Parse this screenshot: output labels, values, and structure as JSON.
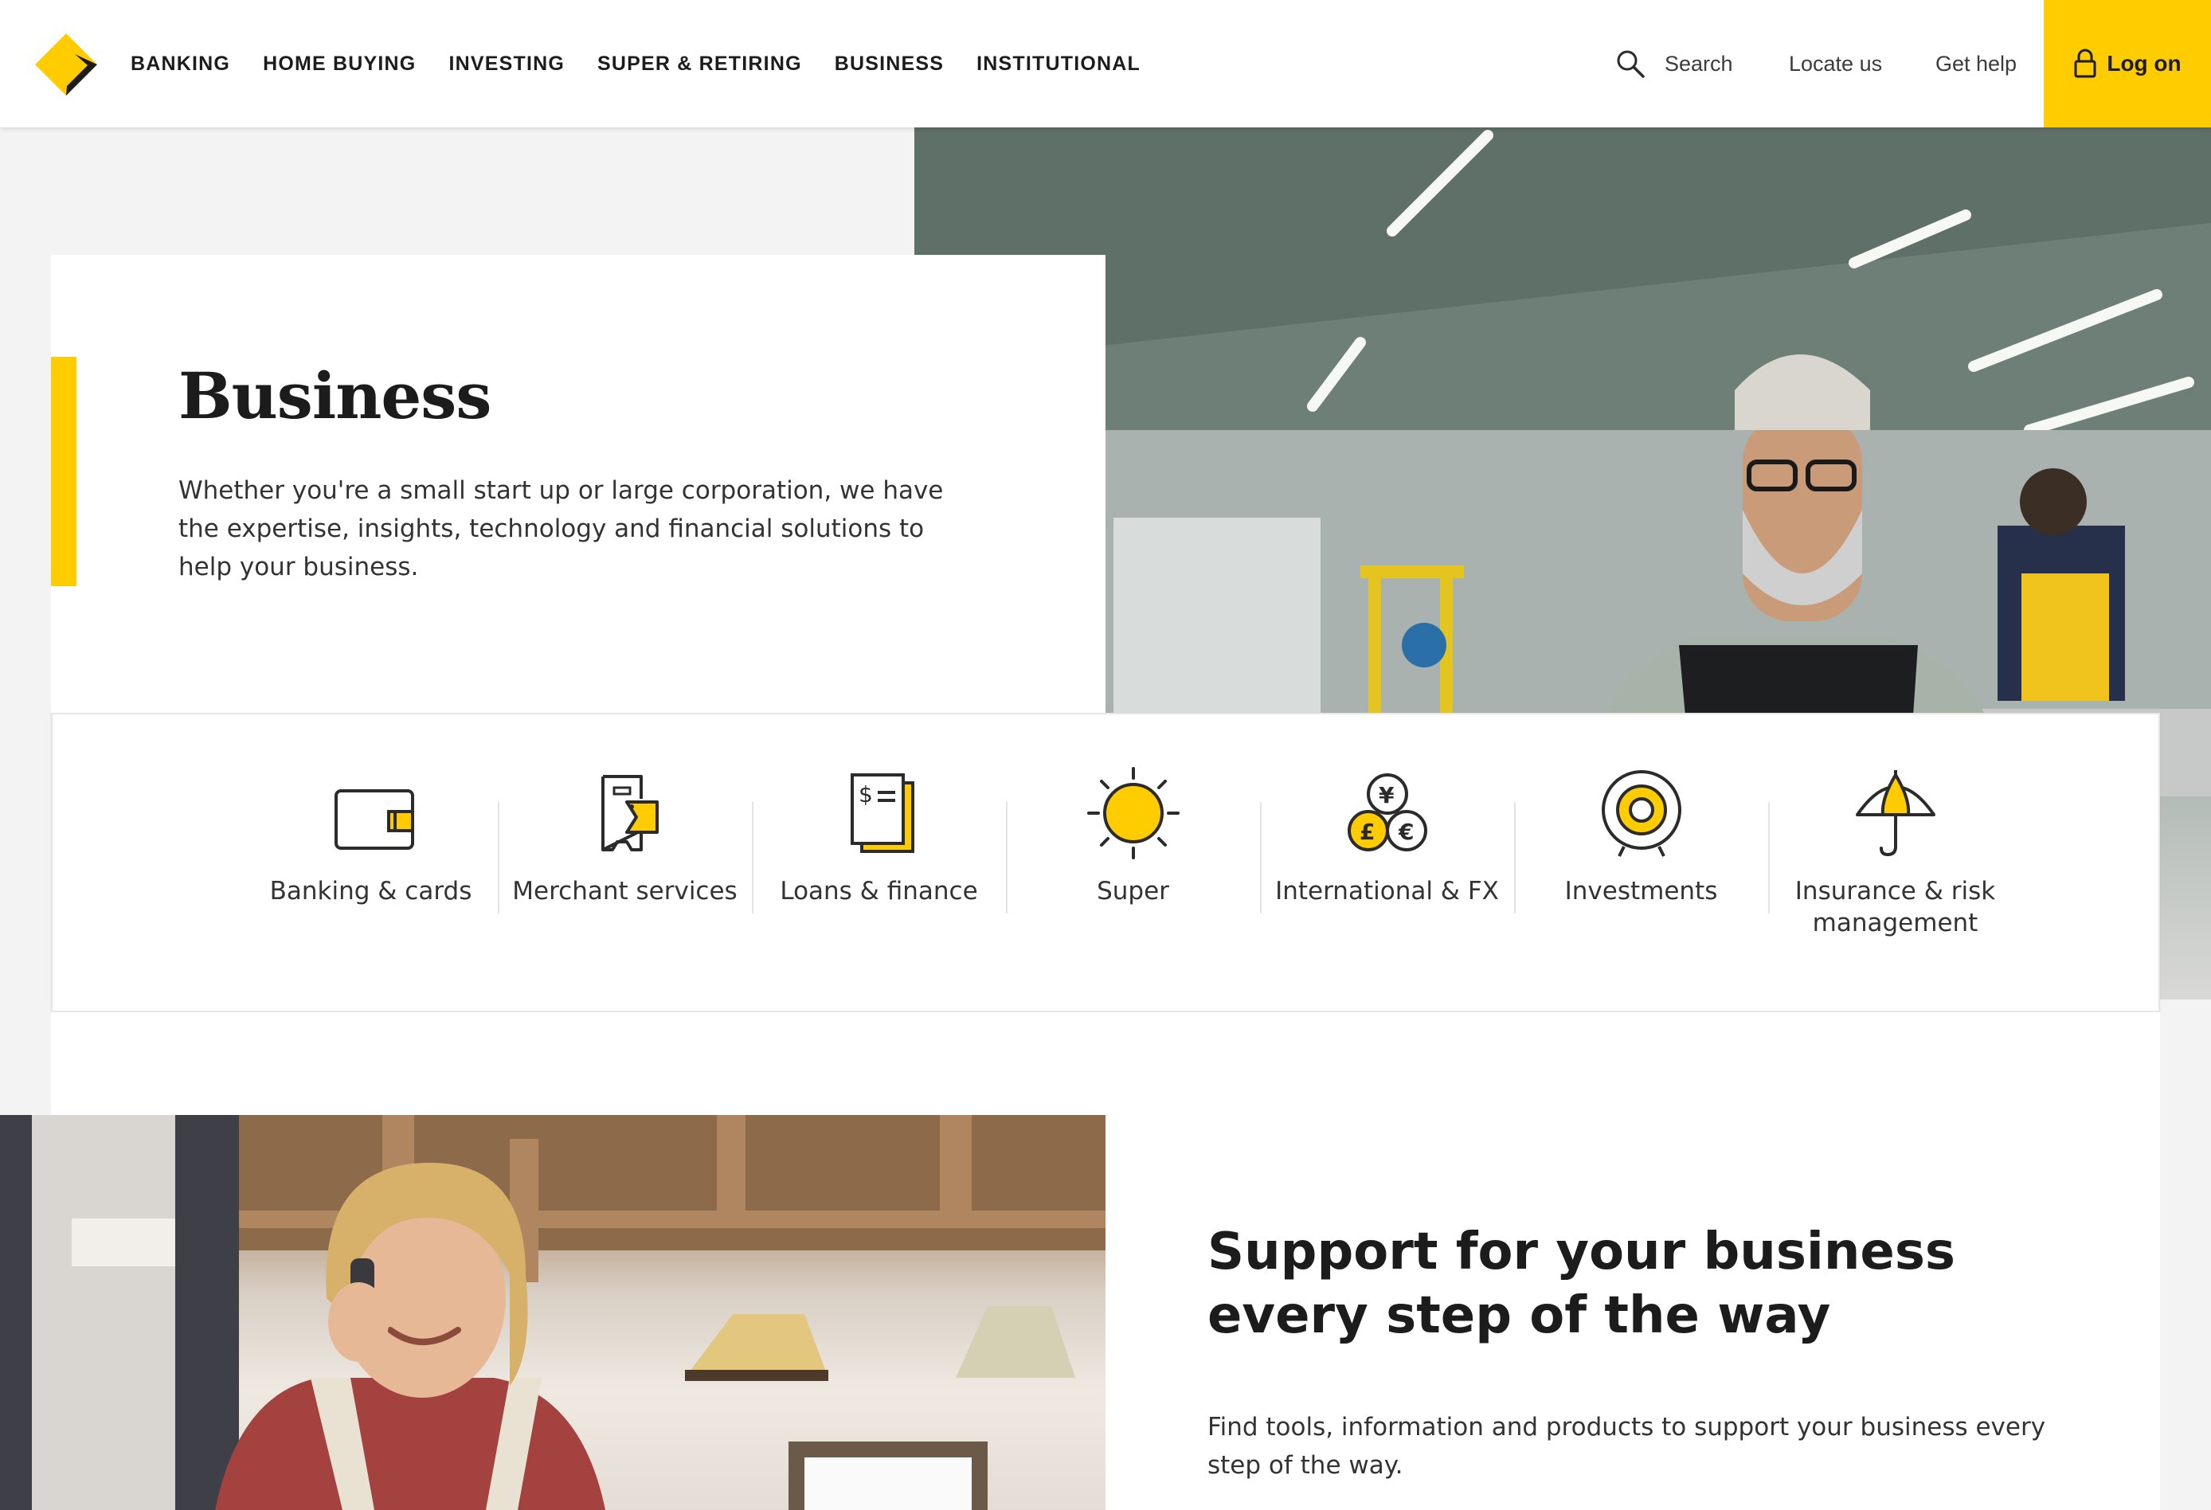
{
  "brand": {
    "accent": "#ffcc00",
    "text": "#1c1c1c"
  },
  "nav": {
    "items": [
      {
        "label": "BANKING"
      },
      {
        "label": "HOME BUYING"
      },
      {
        "label": "INVESTING"
      },
      {
        "label": "SUPER & RETIRING"
      },
      {
        "label": "BUSINESS"
      },
      {
        "label": "INSTITUTIONAL"
      }
    ]
  },
  "utility": {
    "search": "Search",
    "locate": "Locate us",
    "help": "Get help",
    "logon": "Log on"
  },
  "hero": {
    "title": "Business",
    "text": "Whether you're a small start up or large corporation, we have the expertise, insights, technology and financial solutions to help your business."
  },
  "categories": [
    {
      "label": "Banking & cards",
      "icon": "wallet-icon"
    },
    {
      "label": "Merchant services",
      "icon": "eftpos-terminal-icon"
    },
    {
      "label": "Loans & finance",
      "icon": "document-dollar-icon"
    },
    {
      "label": "Super",
      "icon": "sun-icon"
    },
    {
      "label": "International & FX",
      "icon": "currency-coins-icon"
    },
    {
      "label": "Investments",
      "icon": "target-icon"
    },
    {
      "label": "Insurance & risk management",
      "icon": "umbrella-icon"
    }
  ],
  "support": {
    "title": "Support for your business every step of the way",
    "text": "Find tools, information and products to support your business every step of the way."
  }
}
